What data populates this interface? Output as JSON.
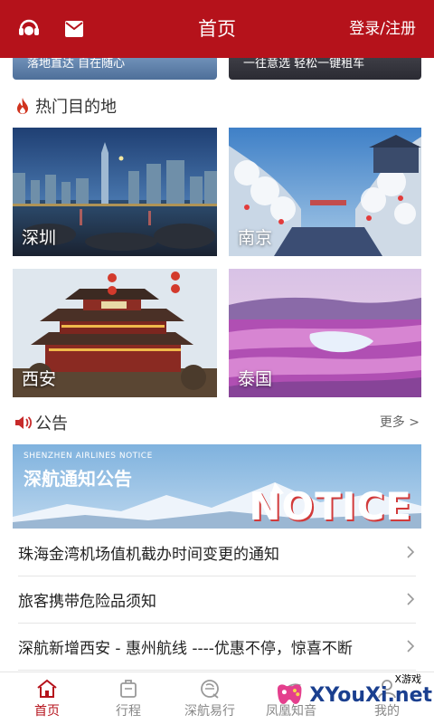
{
  "header": {
    "title": "首页",
    "login_label": "登录/注册"
  },
  "promos": [
    {
      "text": "落地直达 自在随心"
    },
    {
      "text": "一往意选 轻松一键租车"
    }
  ],
  "hot_destinations": {
    "title": "热门目的地",
    "items": [
      {
        "label": "深圳"
      },
      {
        "label": "南京"
      },
      {
        "label": "西安"
      },
      {
        "label": "泰国"
      }
    ]
  },
  "notice": {
    "title": "公告",
    "more_label": "更多 >",
    "banner_sub": "SHENZHEN AIRLINES NOTICE",
    "banner_title": "深航通知公告",
    "banner_word": "NOTICE",
    "items": [
      {
        "text": "珠海金湾机场值机截办时间变更的通知"
      },
      {
        "text": "旅客携带危险品须知"
      },
      {
        "text": "深航新增西安 - 惠州航线 ----优惠不停，惊喜不断"
      }
    ]
  },
  "tabs": [
    {
      "label": "首页",
      "active": true
    },
    {
      "label": "行程",
      "active": false
    },
    {
      "label": "深航易行",
      "active": false
    },
    {
      "label": "凤凰知音",
      "active": false
    },
    {
      "label": "我的",
      "active": false
    }
  ],
  "watermark": {
    "text": "XYouXi.net",
    "small": "X游戏"
  },
  "colors": {
    "brand_red": "#b5121b",
    "text_dark": "#222222",
    "text_gray": "#888888"
  }
}
